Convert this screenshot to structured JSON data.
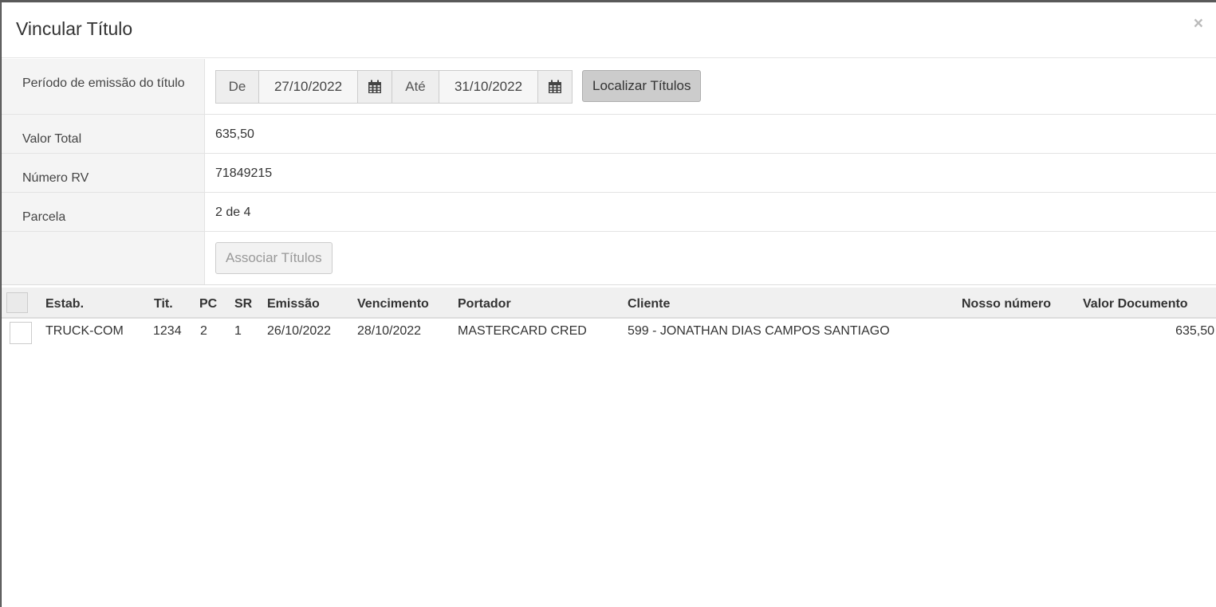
{
  "modal": {
    "title": "Vincular Título",
    "close_label": "×"
  },
  "form": {
    "periodo_label": "Período de emissão do título",
    "de_label": "De",
    "date_from": "27/10/2022",
    "ate_label": "Até",
    "date_to": "31/10/2022",
    "localizar_button": "Localizar Títulos",
    "valor_total_label": "Valor Total",
    "valor_total": "635,50",
    "numero_rv_label": "Número RV",
    "numero_rv": "71849215",
    "parcela_label": "Parcela",
    "parcela": "2 de 4",
    "associar_button": "Associar Títulos"
  },
  "grid": {
    "columns": {
      "estab": "Estab.",
      "tit": "Tit.",
      "pc": "PC",
      "sr": "SR",
      "emissao": "Emissão",
      "vencimento": "Vencimento",
      "portador": "Portador",
      "cliente": "Cliente",
      "nosso_numero": "Nosso número",
      "valor_documento": "Valor Documento"
    },
    "rows": [
      {
        "estab": "TRUCK-COM",
        "tit": "1234",
        "pc": "2",
        "sr": "1",
        "emissao": "26/10/2022",
        "vencimento": "28/10/2022",
        "portador": "MASTERCARD CRED",
        "cliente": "599 - JONATHAN DIAS CAMPOS SANTIAGO",
        "nosso_numero": "",
        "valor_documento": "635,50"
      }
    ]
  },
  "icons": {
    "calendar": "calendar-icon"
  }
}
